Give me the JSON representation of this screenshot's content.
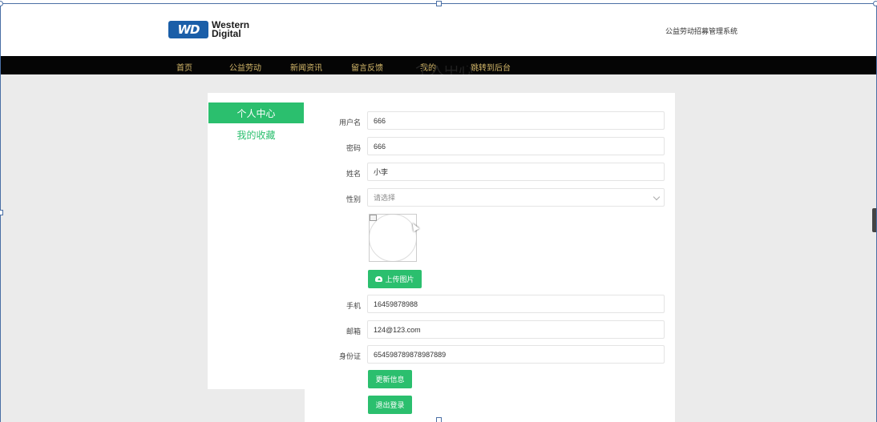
{
  "header": {
    "logo_badge": "WD",
    "logo_line1": "Western",
    "logo_line2": "Digital",
    "site_title": "公益劳动招募管理系统"
  },
  "nav": {
    "items": [
      "首页",
      "公益劳动",
      "新闻资讯",
      "留言反馈",
      "我的",
      "跳转到后台"
    ]
  },
  "page_heading": "个人中心",
  "sidebar": {
    "active": "个人中心",
    "link": "我的收藏"
  },
  "form": {
    "username_label": "用户名",
    "username": "666",
    "password_label": "密码",
    "password": "666",
    "name_label": "姓名",
    "name": "小李",
    "gender_label": "性别",
    "gender_placeholder": "请选择",
    "upload_label": "上传图片",
    "phone_label": "手机",
    "phone": "16459878988",
    "email_label": "邮箱",
    "email": "124@123.com",
    "id_label": "身份证",
    "id_number": "654598789878987889",
    "update_button": "更新信息",
    "logout_button": "退出登录"
  },
  "colors": {
    "accent": "#2bbf6e",
    "nav_bg": "#050505",
    "nav_text": "#d4b86a",
    "logo_blue": "#1a5ea8"
  }
}
